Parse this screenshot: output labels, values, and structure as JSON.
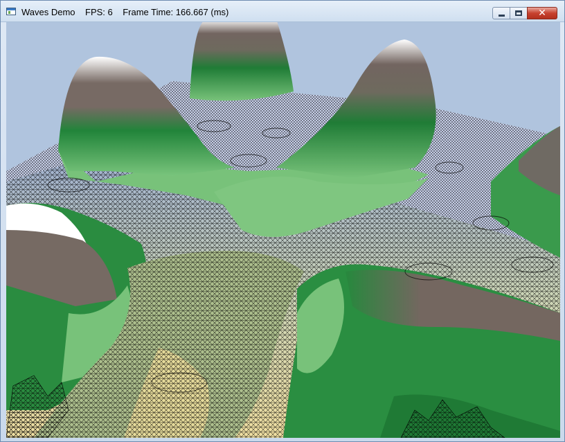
{
  "window": {
    "app_name": "Waves Demo",
    "fps_label": "FPS: 6",
    "frame_time_label": "Frame Time: 166.667 (ms)"
  },
  "caption_buttons": {
    "close_glyph": "✕"
  },
  "scene": {
    "sky_color": "#b0c4de",
    "land_low_color": "#78c27a",
    "land_mid_color": "#1f7a35",
    "rock_color": "#736660",
    "snow_color": "#ffffff",
    "sand_color": "#f2e3a6",
    "wireframe_color": "#000000",
    "water_color": "#b9bfe8"
  }
}
